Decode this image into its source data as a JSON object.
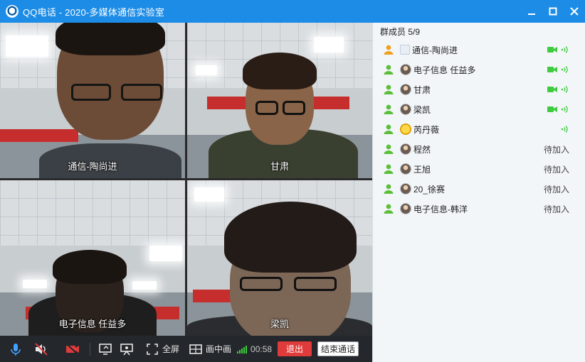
{
  "window": {
    "title": "QQ电话 - 2020-多媒体通信实验室",
    "controls": [
      "minimize-icon",
      "maximize-icon",
      "close-icon"
    ]
  },
  "videos": [
    {
      "name": "通信-陶尚进"
    },
    {
      "name": "甘肃"
    },
    {
      "name": "电子信息 任益多"
    },
    {
      "name": "梁凯"
    }
  ],
  "toolbar": {
    "fullscreen_label": "全屏",
    "pip_label": "画中画",
    "timer": "00:58",
    "exit_label": "退出",
    "end_label": "结束通话",
    "icons": [
      "microphone-icon",
      "speaker-muted-icon",
      "camera-off-icon",
      "screen-share-icon",
      "presentation-icon",
      "fullscreen-icon",
      "picture-in-picture-icon",
      "signal-icon"
    ]
  },
  "panel": {
    "header": "群成员 5/9",
    "members": [
      {
        "name": "通信-陶尚进",
        "status": "video-voice",
        "status_text": ""
      },
      {
        "name": "电子信息 任益多",
        "status": "video-voice",
        "status_text": ""
      },
      {
        "name": "甘肃",
        "status": "video-voice",
        "status_text": ""
      },
      {
        "name": "梁凯",
        "status": "video-voice",
        "status_text": ""
      },
      {
        "name": "芮丹薇",
        "status": "voice",
        "status_text": ""
      },
      {
        "name": "程然",
        "status": "pending",
        "status_text": "待加入"
      },
      {
        "name": "王旭",
        "status": "pending",
        "status_text": "待加入"
      },
      {
        "name": "20_徐赛",
        "status": "pending",
        "status_text": "待加入"
      },
      {
        "name": "电子信息-韩洋",
        "status": "pending",
        "status_text": "待加入"
      }
    ]
  },
  "colors": {
    "titlebar": "#1c8ce6",
    "toolbar": "#24272b",
    "exit_button": "#e03b3b",
    "online_green": "#3ecb3e",
    "panel_bg": "#f3f6f9"
  }
}
